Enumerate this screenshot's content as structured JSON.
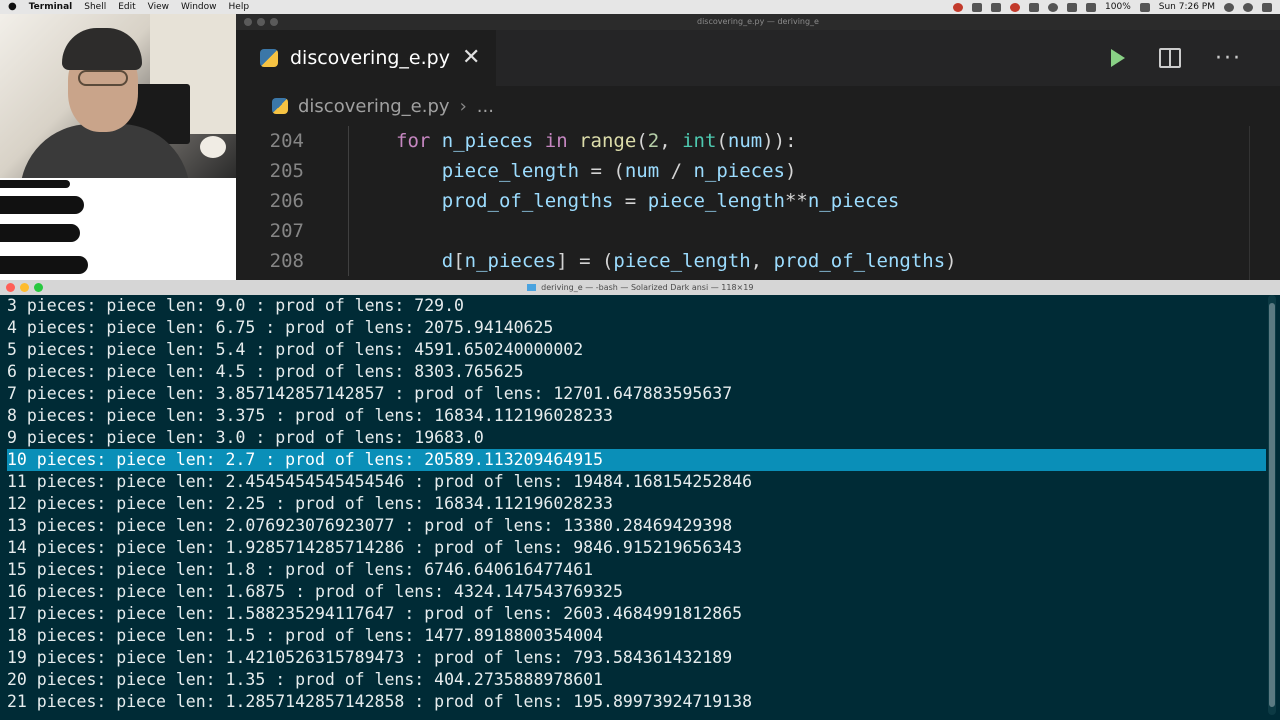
{
  "menubar": {
    "app": "Terminal",
    "items": [
      "Shell",
      "Edit",
      "View",
      "Window",
      "Help"
    ],
    "battery": "100%",
    "clock": "Sun 7:26 PM"
  },
  "vscode": {
    "window_title": "discovering_e.py — deriving_e",
    "tab_label": "discovering_e.py",
    "close_glyph": "✕",
    "breadcrumb_file": "discovering_e.py",
    "breadcrumb_sep": "›",
    "breadcrumb_more": "...",
    "more_glyph": "···",
    "code_lines": [
      {
        "n": "204",
        "text": "for n_pieces in range(2, int(num)):"
      },
      {
        "n": "205",
        "text": "    piece_length = (num / n_pieces)"
      },
      {
        "n": "206",
        "text": "    prod_of_lengths = piece_length**n_pieces"
      },
      {
        "n": "207",
        "text": ""
      },
      {
        "n": "208",
        "text": "    d[n_pieces] = (piece_length, prod_of_lengths)"
      }
    ]
  },
  "terminal": {
    "title": "deriving_e — -bash — Solarized Dark ansi — 118×19",
    "selected_index": 7,
    "lines": [
      "3 pieces: piece len: 9.0 : prod of lens: 729.0",
      "4 pieces: piece len: 6.75 : prod of lens: 2075.94140625",
      "5 pieces: piece len: 5.4 : prod of lens: 4591.650240000002",
      "6 pieces: piece len: 4.5 : prod of lens: 8303.765625",
      "7 pieces: piece len: 3.857142857142857 : prod of lens: 12701.647883595637",
      "8 pieces: piece len: 3.375 : prod of lens: 16834.112196028233",
      "9 pieces: piece len: 3.0 : prod of lens: 19683.0",
      "10 pieces: piece len: 2.7 : prod of lens: 20589.113209464915",
      "11 pieces: piece len: 2.4545454545454546 : prod of lens: 19484.168154252846",
      "12 pieces: piece len: 2.25 : prod of lens: 16834.112196028233",
      "13 pieces: piece len: 2.076923076923077 : prod of lens: 13380.28469429398",
      "14 pieces: piece len: 1.9285714285714286 : prod of lens: 9846.915219656343",
      "15 pieces: piece len: 1.8 : prod of lens: 6746.640616477461",
      "16 pieces: piece len: 1.6875 : prod of lens: 4324.147543769325",
      "17 pieces: piece len: 1.588235294117647 : prod of lens: 2603.4684991812865",
      "18 pieces: piece len: 1.5 : prod of lens: 1477.8918800354004",
      "19 pieces: piece len: 1.4210526315789473 : prod of lens: 793.584361432189",
      "20 pieces: piece len: 1.35 : prod of lens: 404.2735888978601",
      "21 pieces: piece len: 1.2857142857142858 : prod of lens: 195.89973924719138"
    ]
  }
}
